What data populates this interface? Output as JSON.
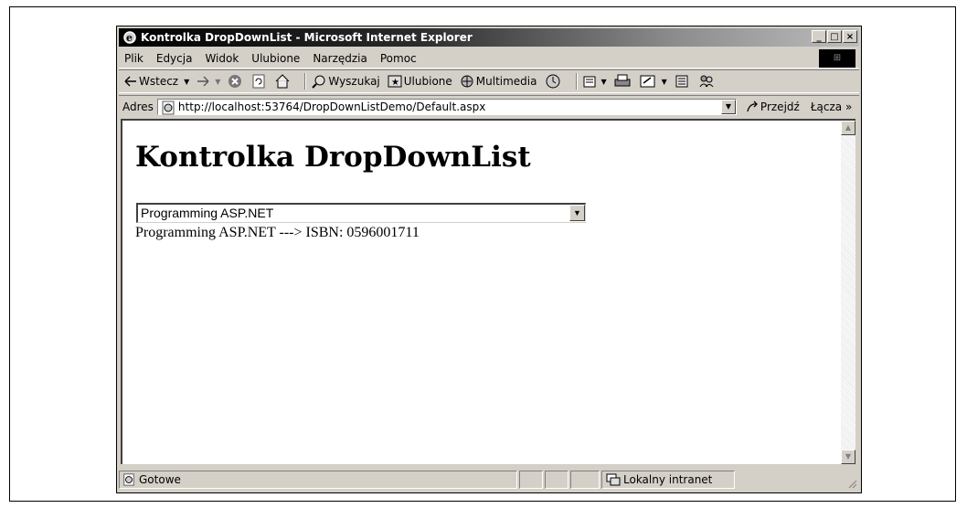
{
  "window": {
    "title": "Kontrolka DropDownList - Microsoft Internet Explorer",
    "minimize": "_",
    "maximize": "□",
    "close": "×"
  },
  "menu": {
    "items": [
      "Plik",
      "Edycja",
      "Widok",
      "Ulubione",
      "Narzędzia",
      "Pomoc"
    ]
  },
  "toolbar": {
    "back_label": "Wstecz",
    "search_label": "Wyszukaj",
    "favorites_label": "Ulubione",
    "multimedia_label": "Multimedia"
  },
  "address": {
    "label": "Adres",
    "url": "http://localhost:53764/DropDownListDemo/Default.aspx",
    "go_label": "Przejdź",
    "links_label": "Łącza »"
  },
  "page": {
    "heading": "Kontrolka DropDownList",
    "dropdown_selected": "Programming ASP.NET",
    "result_text": "Programming ASP.NET ---> ISBN: 0596001711"
  },
  "status": {
    "text": "Gotowe",
    "zone": "Lokalny intranet"
  },
  "icons": {
    "app": "ie-icon",
    "stop": "stop-icon",
    "refresh": "refresh-icon",
    "home": "home-icon",
    "history": "history-icon",
    "mail": "mail-icon",
    "print": "print-icon",
    "edit": "edit-icon"
  }
}
